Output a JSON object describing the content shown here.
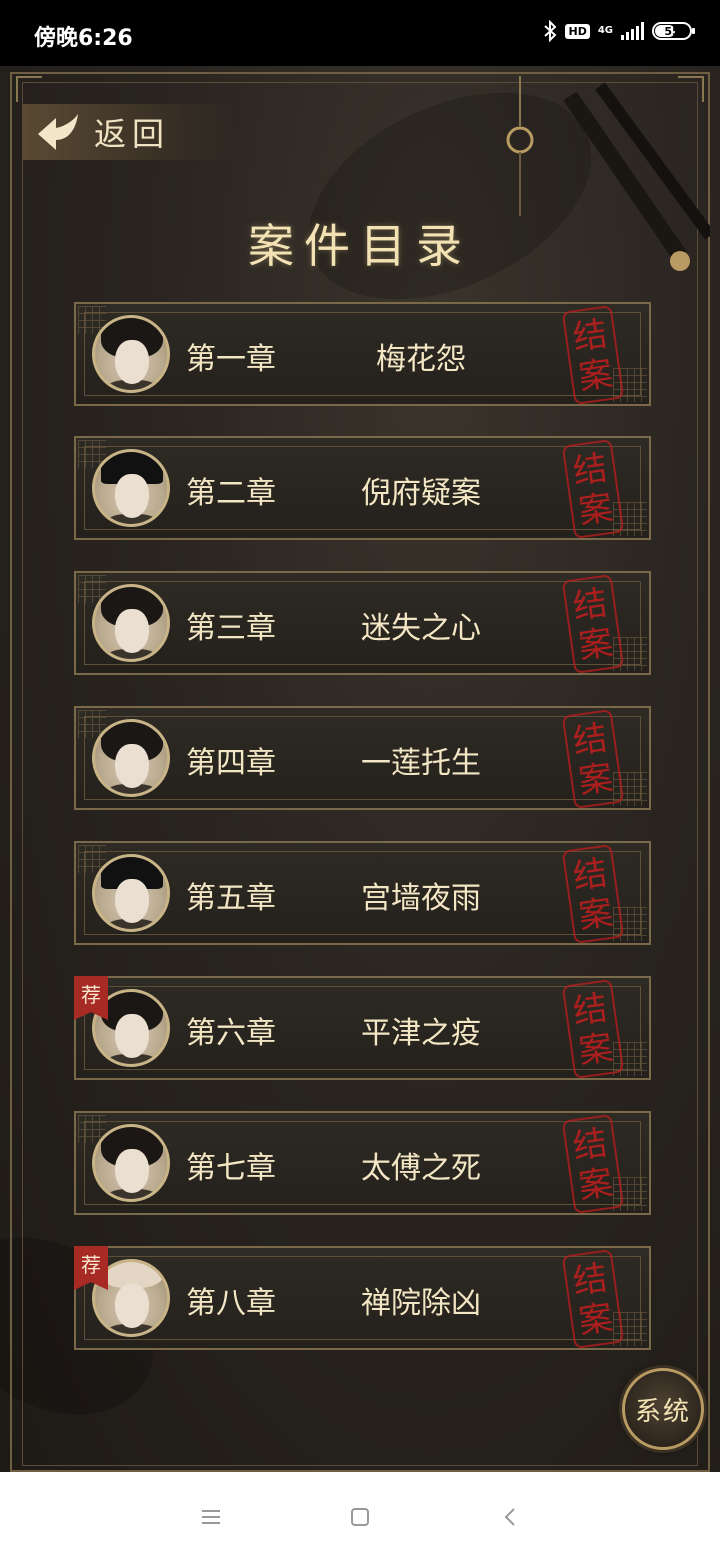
{
  "status": {
    "time": "傍晚6:26",
    "network": "4G",
    "hd": "HD",
    "battery": "55",
    "battery_level": 0.55
  },
  "header": {
    "back_label": "返回",
    "title": "案件目录"
  },
  "chapters": [
    {
      "number": "第一章",
      "name": "梅花怨",
      "stamp": "结案",
      "recommended": false,
      "avatar": "long-hair-woman"
    },
    {
      "number": "第二章",
      "name": "倪府疑案",
      "stamp": "结案",
      "recommended": false,
      "avatar": "bearded-man"
    },
    {
      "number": "第三章",
      "name": "迷失之心",
      "stamp": "结案",
      "recommended": false,
      "avatar": "young-man"
    },
    {
      "number": "第四章",
      "name": "一莲托生",
      "stamp": "结案",
      "recommended": false,
      "avatar": "woman"
    },
    {
      "number": "第五章",
      "name": "宫墙夜雨",
      "stamp": "结案",
      "recommended": false,
      "avatar": "official-hat"
    },
    {
      "number": "第六章",
      "name": "平津之疫",
      "stamp": "结案",
      "recommended": true,
      "badge": "荐",
      "avatar": "young-man"
    },
    {
      "number": "第七章",
      "name": "太傅之死",
      "stamp": "结案",
      "recommended": false,
      "avatar": "man"
    },
    {
      "number": "第八章",
      "name": "禅院除凶",
      "stamp": "结案",
      "recommended": true,
      "badge": "荐",
      "avatar": "bald-monk"
    }
  ],
  "system_button": "系统",
  "colors": {
    "title": "#f3e3b4",
    "stamp": "#c21f1f",
    "badge": "#a82a24",
    "frame": "#7a6a4a"
  }
}
